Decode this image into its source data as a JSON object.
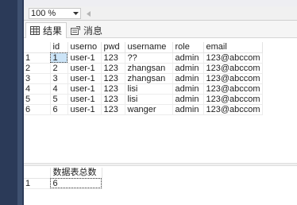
{
  "zoom": {
    "value": "100 %"
  },
  "tabs": [
    {
      "label": "结果",
      "icon": "grid-icon"
    },
    {
      "label": "消息",
      "icon": "message-icon"
    }
  ],
  "results": {
    "columns": [
      "id",
      "userno",
      "pwd",
      "username",
      "role",
      "email"
    ],
    "rows": [
      {
        "n": "1",
        "cells": [
          "1",
          "user-1",
          "123",
          "??",
          "admin",
          "123@abccom"
        ]
      },
      {
        "n": "2",
        "cells": [
          "2",
          "user-1",
          "123",
          "zhangsan",
          "admin",
          "123@abccom"
        ]
      },
      {
        "n": "3",
        "cells": [
          "3",
          "user-1",
          "123",
          "zhangsan",
          "admin",
          "123@abccom"
        ]
      },
      {
        "n": "4",
        "cells": [
          "4",
          "user-1",
          "123",
          "lisi",
          "admin",
          "123@abccom"
        ]
      },
      {
        "n": "5",
        "cells": [
          "5",
          "user-1",
          "123",
          "lisi",
          "admin",
          "123@abccom"
        ]
      },
      {
        "n": "6",
        "cells": [
          "6",
          "user-1",
          "123",
          "wanger",
          "admin",
          "123@abccom"
        ]
      }
    ]
  },
  "count_result": {
    "column": "数据表总数",
    "row_number": "1",
    "value": "6"
  },
  "colors": {
    "selected_cell": "#cce4f7",
    "left_bar": "#2b3a58"
  }
}
